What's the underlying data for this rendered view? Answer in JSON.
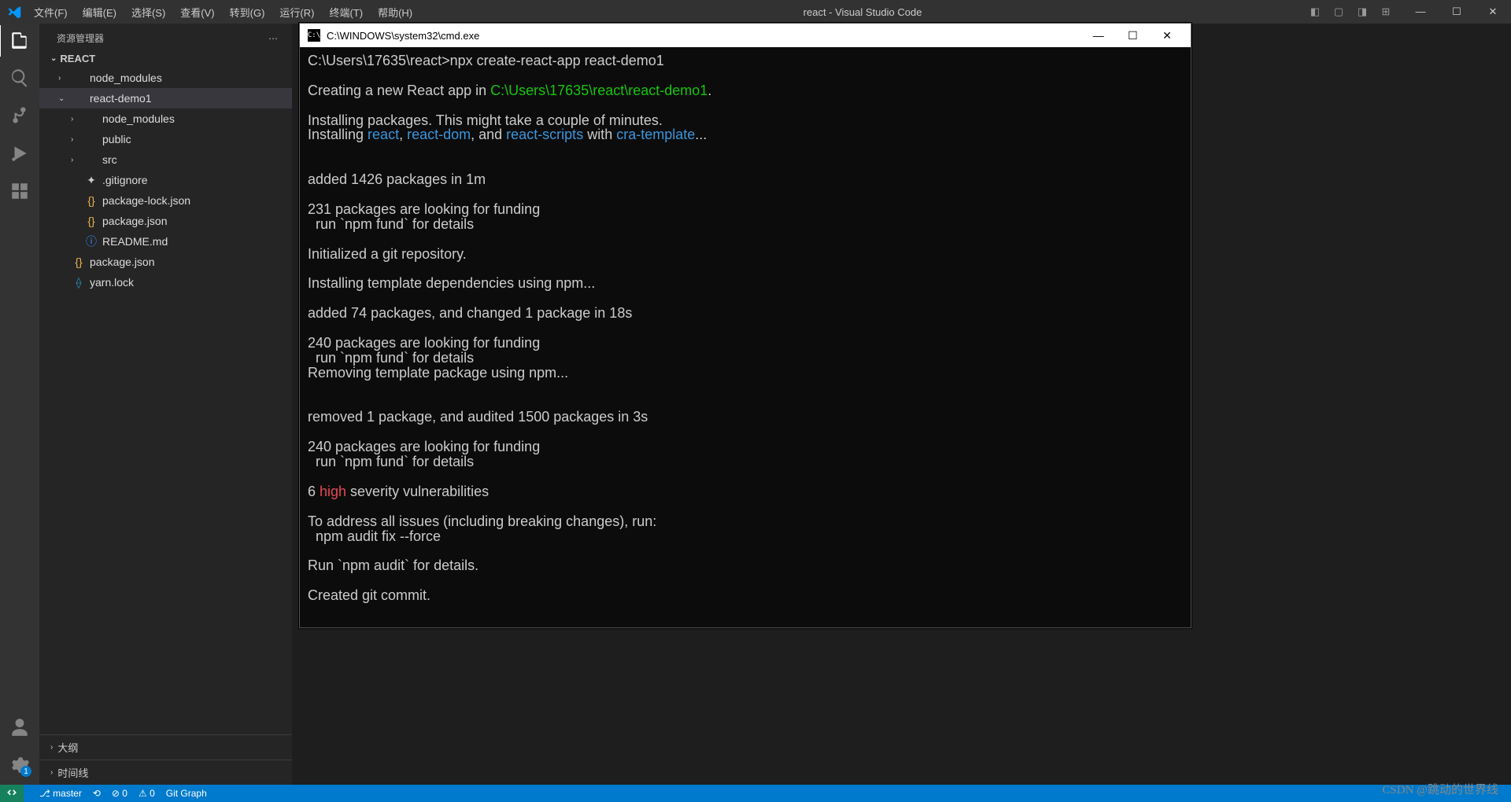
{
  "titlebar": {
    "menus": [
      "文件(F)",
      "编辑(E)",
      "选择(S)",
      "查看(V)",
      "转到(G)",
      "运行(R)",
      "终端(T)",
      "帮助(H)"
    ],
    "title": "react - Visual Studio Code"
  },
  "sidebar": {
    "header": "资源管理器",
    "rootName": "REACT",
    "tree": [
      {
        "indent": 1,
        "twisty": ">",
        "iconClass": "ic-folder",
        "icon": "",
        "label": "node_modules"
      },
      {
        "indent": 1,
        "twisty": "v",
        "iconClass": "ic-folder",
        "icon": "",
        "label": "react-demo1",
        "selected": true
      },
      {
        "indent": 2,
        "twisty": ">",
        "iconClass": "ic-folder",
        "icon": "",
        "label": "node_modules"
      },
      {
        "indent": 2,
        "twisty": ">",
        "iconClass": "ic-folder",
        "icon": "",
        "label": "public"
      },
      {
        "indent": 2,
        "twisty": ">",
        "iconClass": "ic-folder",
        "icon": "",
        "label": "src"
      },
      {
        "indent": 2,
        "twisty": "",
        "iconClass": "ic-git",
        "icon": "✦",
        "label": ".gitignore"
      },
      {
        "indent": 2,
        "twisty": "",
        "iconClass": "ic-braces",
        "icon": "{}",
        "label": "package-lock.json"
      },
      {
        "indent": 2,
        "twisty": "",
        "iconClass": "ic-braces",
        "icon": "{}",
        "label": "package.json"
      },
      {
        "indent": 2,
        "twisty": "",
        "iconClass": "ic-info",
        "icon": "ⓘ",
        "label": "README.md"
      },
      {
        "indent": 1,
        "twisty": "",
        "iconClass": "ic-braces",
        "icon": "{}",
        "label": "package.json"
      },
      {
        "indent": 1,
        "twisty": "",
        "iconClass": "ic-yarn",
        "icon": "⟠",
        "label": "yarn.lock"
      }
    ],
    "panels": [
      "大纲",
      "时间线"
    ]
  },
  "terminal": {
    "title": "C:\\WINDOWS\\system32\\cmd.exe",
    "lines": [
      [
        {
          "c": "w",
          "t": "C:\\Users\\17635\\react>npx create-react-app react-demo1"
        }
      ],
      [],
      [
        {
          "c": "w",
          "t": "Creating a new React app in "
        },
        {
          "c": "g",
          "t": "C:\\Users\\17635\\react\\react-demo1"
        },
        {
          "c": "w",
          "t": "."
        }
      ],
      [],
      [
        {
          "c": "w",
          "t": "Installing packages. This might take a couple of minutes."
        }
      ],
      [
        {
          "c": "w",
          "t": "Installing "
        },
        {
          "c": "c",
          "t": "react"
        },
        {
          "c": "w",
          "t": ", "
        },
        {
          "c": "c",
          "t": "react-dom"
        },
        {
          "c": "w",
          "t": ", and "
        },
        {
          "c": "c",
          "t": "react-scripts"
        },
        {
          "c": "w",
          "t": " with "
        },
        {
          "c": "c",
          "t": "cra-template"
        },
        {
          "c": "w",
          "t": "..."
        }
      ],
      [],
      [],
      [
        {
          "c": "w",
          "t": "added 1426 packages in 1m"
        }
      ],
      [],
      [
        {
          "c": "w",
          "t": "231 packages are looking for funding"
        }
      ],
      [
        {
          "c": "w",
          "t": "  run `npm fund` for details"
        }
      ],
      [],
      [
        {
          "c": "w",
          "t": "Initialized a git repository."
        }
      ],
      [],
      [
        {
          "c": "w",
          "t": "Installing template dependencies using npm..."
        }
      ],
      [],
      [
        {
          "c": "w",
          "t": "added 74 packages, and changed 1 package in 18s"
        }
      ],
      [],
      [
        {
          "c": "w",
          "t": "240 packages are looking for funding"
        }
      ],
      [
        {
          "c": "w",
          "t": "  run `npm fund` for details"
        }
      ],
      [
        {
          "c": "w",
          "t": "Removing template package using npm..."
        }
      ],
      [],
      [],
      [
        {
          "c": "w",
          "t": "removed 1 package, and audited 1500 packages in 3s"
        }
      ],
      [],
      [
        {
          "c": "w",
          "t": "240 packages are looking for funding"
        }
      ],
      [
        {
          "c": "w",
          "t": "  run `npm fund` for details"
        }
      ],
      [],
      [
        {
          "c": "w",
          "t": "6 "
        },
        {
          "c": "r",
          "t": "high"
        },
        {
          "c": "w",
          "t": " severity vulnerabilities"
        }
      ],
      [],
      [
        {
          "c": "w",
          "t": "To address all issues (including breaking changes), run:"
        }
      ],
      [
        {
          "c": "w",
          "t": "  npm audit fix --force"
        }
      ],
      [],
      [
        {
          "c": "w",
          "t": "Run `npm audit` for details."
        }
      ],
      [],
      [
        {
          "c": "w",
          "t": "Created git commit."
        }
      ]
    ]
  },
  "statusbar": {
    "branch": "master",
    "sync": "⟲",
    "errors": "⊘ 0",
    "warnings": "⚠ 0",
    "gitGraph": "Git Graph"
  },
  "activity": {
    "settingsBadge": "1"
  },
  "watermark": "CSDN @跳动的世界线"
}
